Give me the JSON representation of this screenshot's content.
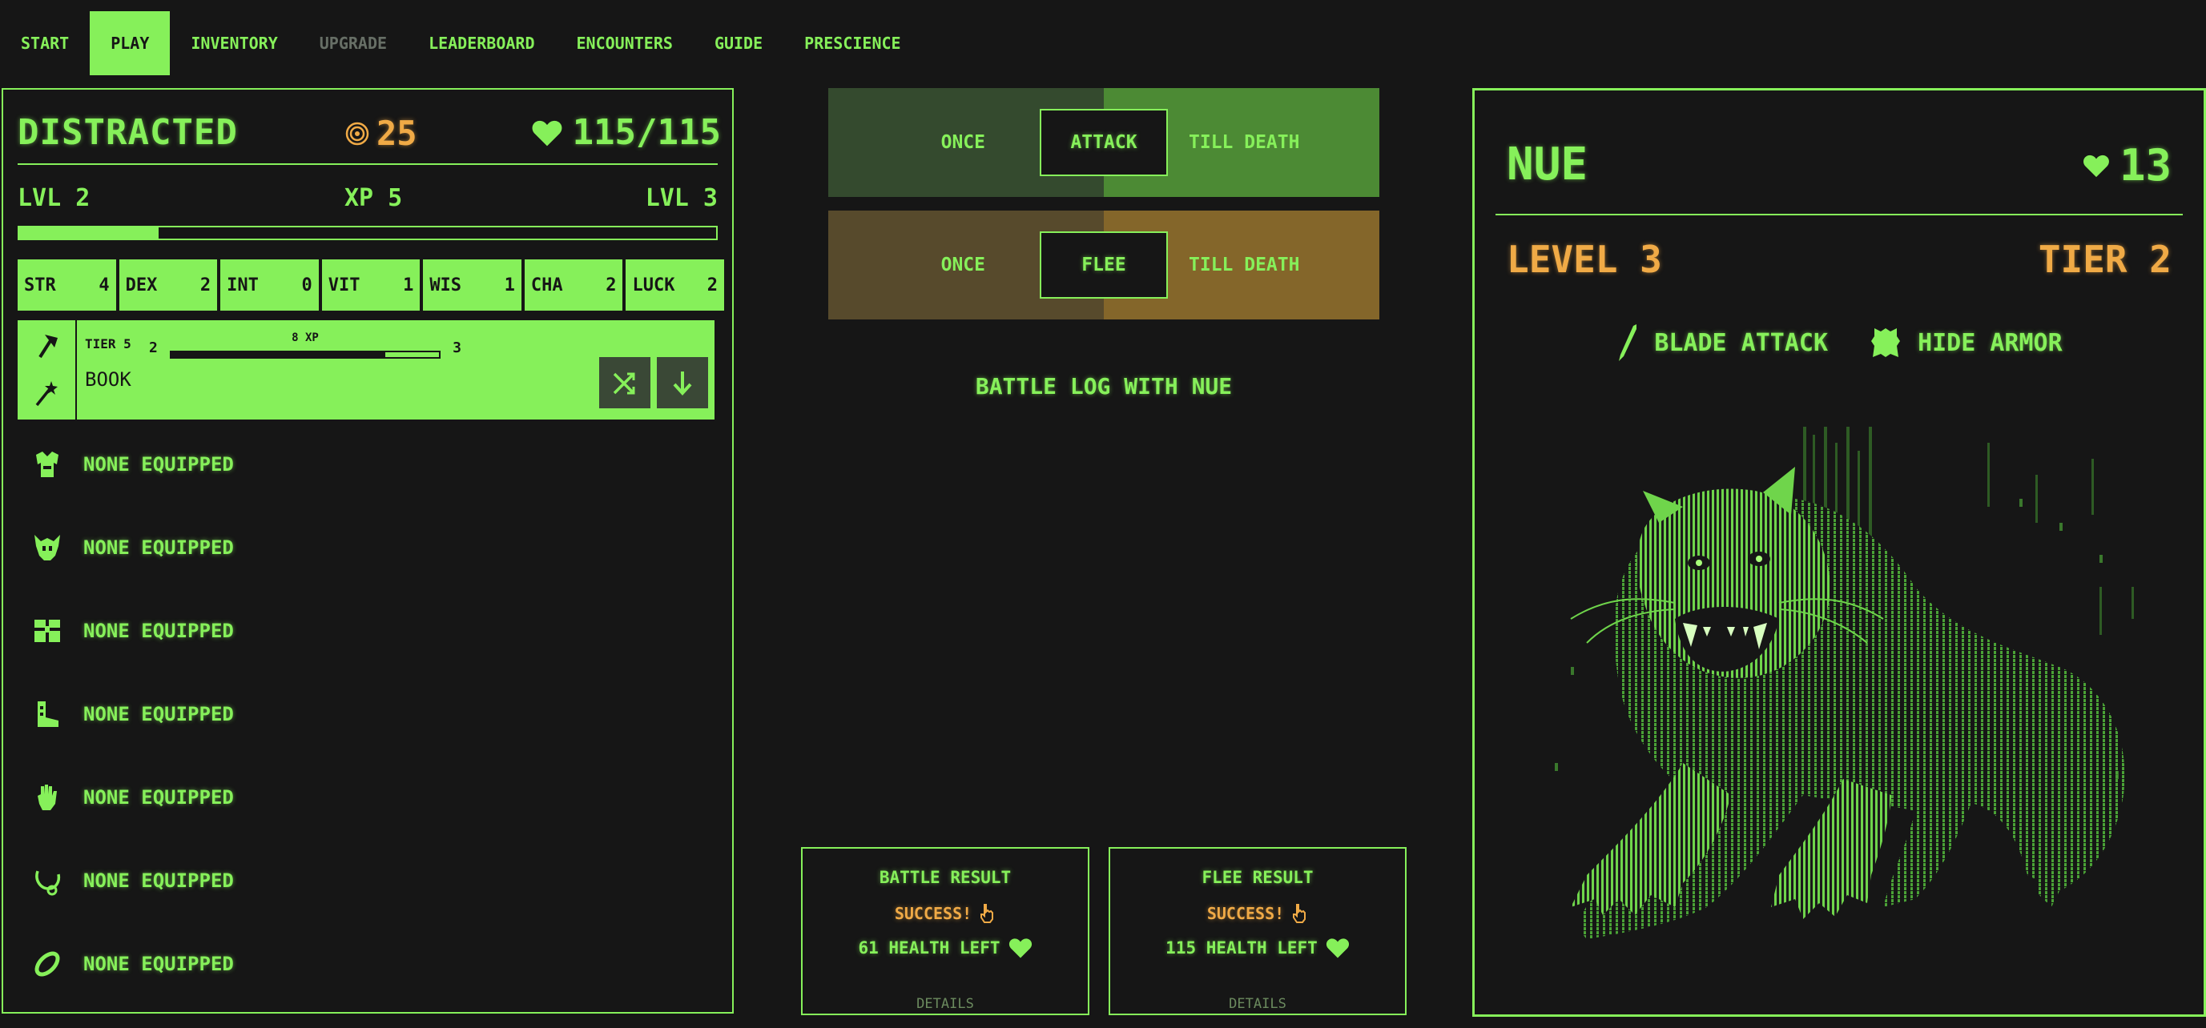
{
  "nav": {
    "tabs": [
      {
        "label": "START",
        "state": "normal"
      },
      {
        "label": "PLAY",
        "state": "active"
      },
      {
        "label": "INVENTORY",
        "state": "normal"
      },
      {
        "label": "UPGRADE",
        "state": "disabled"
      },
      {
        "label": "LEADERBOARD",
        "state": "normal"
      },
      {
        "label": "ENCOUNTERS",
        "state": "normal"
      },
      {
        "label": "GUIDE",
        "state": "normal"
      },
      {
        "label": "PRESCIENCE",
        "state": "normal"
      }
    ]
  },
  "player": {
    "name": "DISTRACTED",
    "gold": "25",
    "health": "115/115",
    "level_current": "LVL 2",
    "xp": "XP 5",
    "level_next": "LVL 3",
    "xp_progress_fraction": 0.2,
    "stats": [
      {
        "name": "STR",
        "value": "4"
      },
      {
        "name": "DEX",
        "value": "2"
      },
      {
        "name": "INT",
        "value": "0"
      },
      {
        "name": "VIT",
        "value": "1"
      },
      {
        "name": "WIS",
        "value": "1"
      },
      {
        "name": "CHA",
        "value": "2"
      },
      {
        "name": "LUCK",
        "value": "2"
      }
    ],
    "weapon": {
      "tier": "TIER 5",
      "xp_label": "8 XP",
      "level_from": "2",
      "level_to": "3",
      "xp_progress_fraction": 0.8,
      "name": "BOOK"
    },
    "slots": [
      {
        "icon": "chest-armor-icon",
        "label": "NONE EQUIPPED"
      },
      {
        "icon": "helmet-icon",
        "label": "NONE EQUIPPED"
      },
      {
        "icon": "waist-belt-icon",
        "label": "NONE EQUIPPED"
      },
      {
        "icon": "boot-icon",
        "label": "NONE EQUIPPED"
      },
      {
        "icon": "glove-icon",
        "label": "NONE EQUIPPED"
      },
      {
        "icon": "necklace-icon",
        "label": "NONE EQUIPPED"
      },
      {
        "icon": "ring-icon",
        "label": "NONE EQUIPPED"
      }
    ]
  },
  "actions": {
    "attack": {
      "once": "ONCE",
      "button": "ATTACK",
      "till_death": "TILL DEATH"
    },
    "flee": {
      "once": "ONCE",
      "button": "FLEE",
      "till_death": "TILL DEATH"
    }
  },
  "battle_log_title": "BATTLE LOG WITH NUE",
  "results": {
    "battle": {
      "title": "BATTLE RESULT",
      "status": "SUCCESS!",
      "health": "61 HEALTH LEFT",
      "details": "DETAILS"
    },
    "flee": {
      "title": "FLEE RESULT",
      "status": "SUCCESS!",
      "health": "115 HEALTH LEFT",
      "details": "DETAILS"
    }
  },
  "enemy": {
    "name": "NUE",
    "health": "13",
    "level": "LEVEL 3",
    "tier": "TIER 2",
    "attack": "BLADE ATTACK",
    "armor": "HIDE ARMOR",
    "image_icon": "nue-beast-illustration"
  },
  "colors": {
    "background": "#161616",
    "accent_green": "#86f05a",
    "gold_orange": "#f0aa46",
    "attack_dark": "#344a2e",
    "attack_light": "#4c8a34",
    "flee_dark": "#574a2c",
    "flee_light": "#84662a",
    "disabled": "#676f66"
  }
}
